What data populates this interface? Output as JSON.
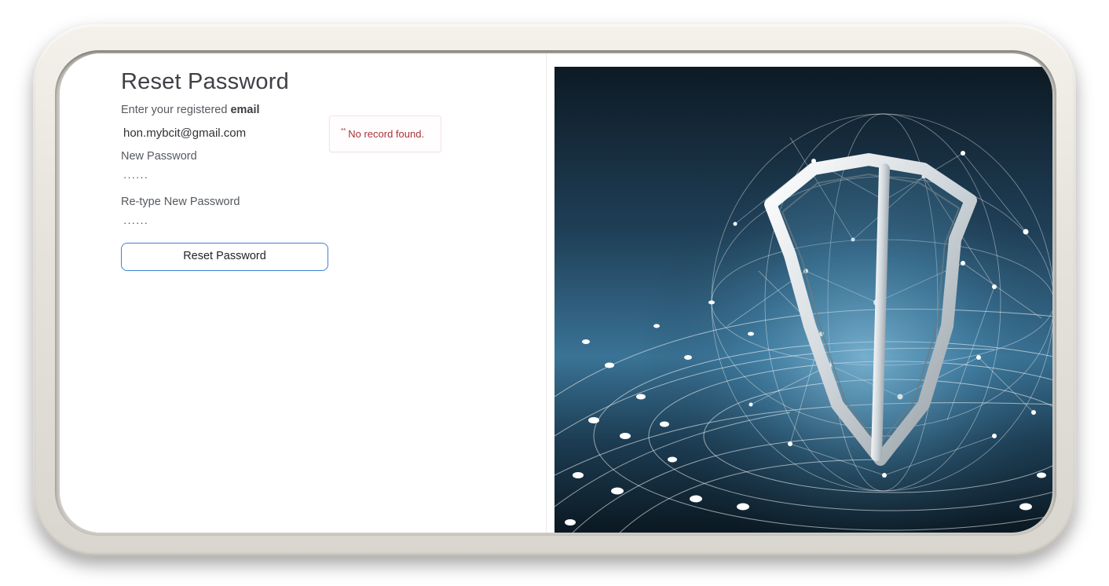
{
  "page": {
    "title": "Reset Password",
    "email_label_prefix": "Enter your registered ",
    "email_label_bold": "email",
    "email_value": "hon.mybcit@gmail.com",
    "new_password_label": "New Password",
    "new_password_value": "······",
    "retype_password_label": "Re-type New Password",
    "retype_password_value": "······",
    "submit_label": "Reset Password"
  },
  "error": {
    "marker": "**",
    "message": "No record found."
  },
  "illustration": {
    "icon": "security-shield-network-globe",
    "colors": {
      "bg_dark": "#0d1a24",
      "bg_mid": "#2d5f7e",
      "bg_light": "#6aa6c8"
    }
  }
}
